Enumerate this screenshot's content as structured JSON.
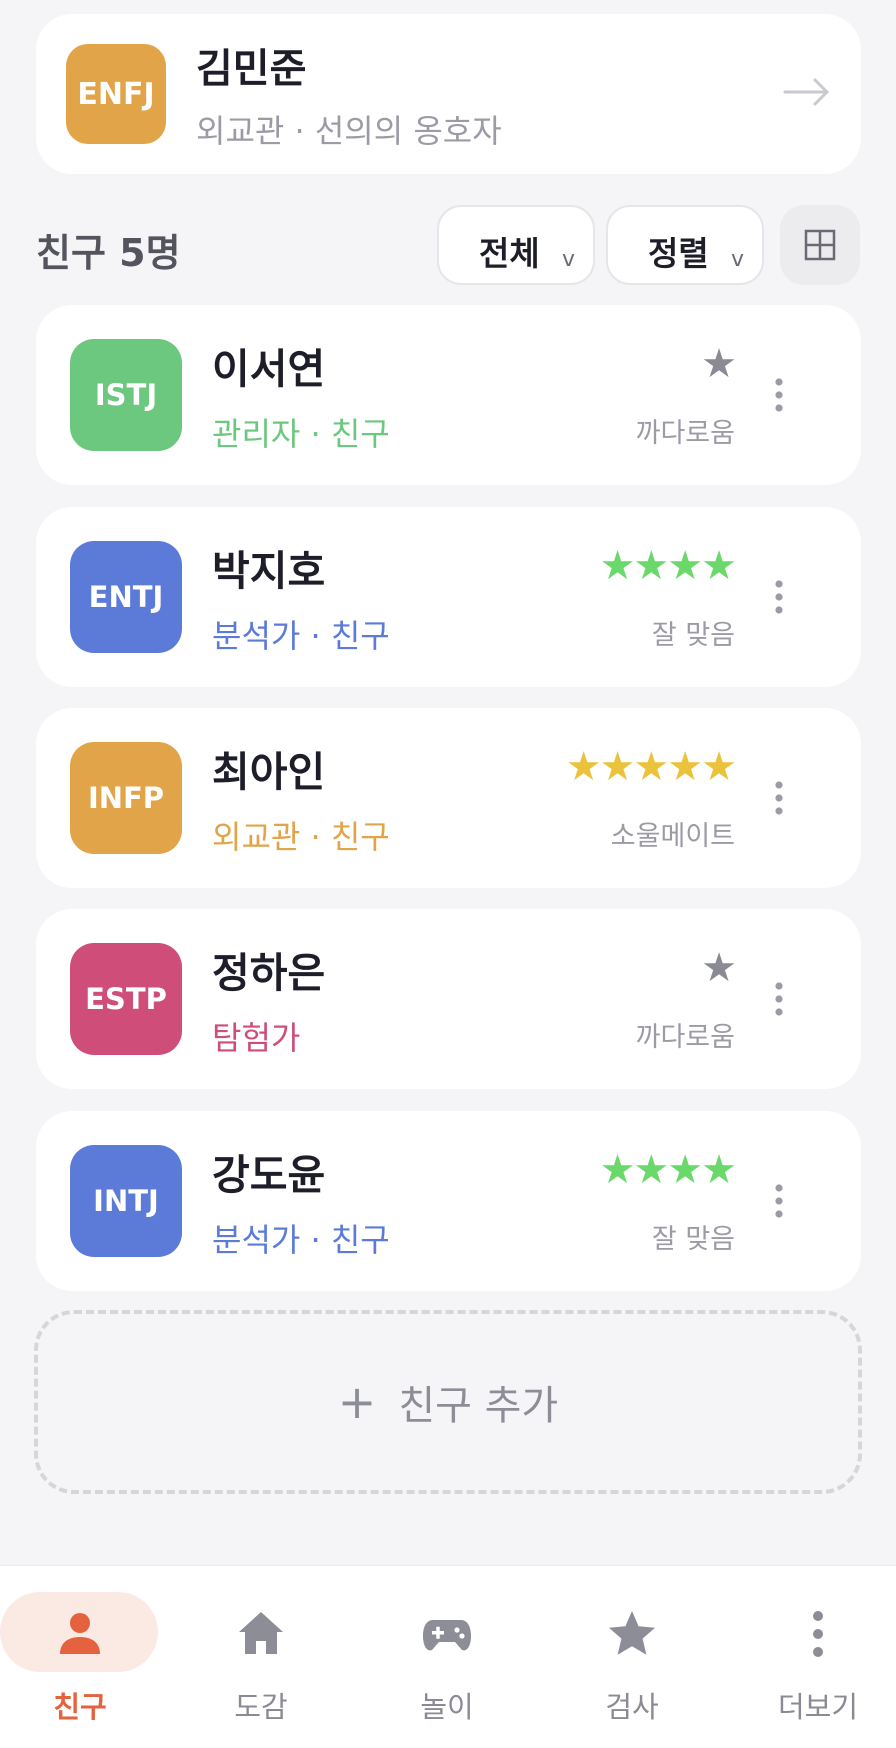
{
  "colors": {
    "accent": "#e4623e",
    "diplomat": "#e2a449",
    "sentinel": "#6cc77f",
    "analyst": "#5c7bd9",
    "explorer": "#cf4e79",
    "star_green": "#6ad86a",
    "star_gold": "#ebc23c",
    "star_gray": "#8a8a94"
  },
  "profile": {
    "mbti": "ENFJ",
    "name": "김민준",
    "subtitle": "외교관 · 선의의 옹호자",
    "arrow_icon": "arrow-right-icon"
  },
  "toolbar": {
    "count_label": "친구 5명",
    "filter_label": "전체",
    "sort_label": "정렬",
    "chevron": "v",
    "grid_icon": "grid-view-icon"
  },
  "friends": [
    {
      "mbti": "ISTJ",
      "name": "이서연",
      "subtitle": "관리자 · 친구",
      "stars": "★",
      "star_count": 1,
      "rating": "까다로움"
    },
    {
      "mbti": "ENTJ",
      "name": "박지호",
      "subtitle": "분석가 · 친구",
      "stars": "★★★★",
      "star_count": 4,
      "rating": "잘 맞음"
    },
    {
      "mbti": "INFP",
      "name": "최아인",
      "subtitle": "외교관 · 친구",
      "stars": "★★★★★",
      "star_count": 5,
      "rating": "소울메이트"
    },
    {
      "mbti": "ESTP",
      "name": "정하은",
      "subtitle": "탐험가",
      "stars": "★",
      "star_count": 1,
      "rating": "까다로움"
    },
    {
      "mbti": "INTJ",
      "name": "강도윤",
      "subtitle": "분석가 · 친구",
      "stars": "★★★★",
      "star_count": 4,
      "rating": "잘 맞음"
    }
  ],
  "add_friend": {
    "plus": "+",
    "label": "친구 추가"
  },
  "nav": {
    "items": [
      {
        "label": "친구",
        "icon": "person-icon",
        "active": true
      },
      {
        "label": "도감",
        "icon": "home-icon",
        "active": false
      },
      {
        "label": "놀이",
        "icon": "gamepad-icon",
        "active": false
      },
      {
        "label": "검사",
        "icon": "star-icon",
        "active": false
      },
      {
        "label": "더보기",
        "icon": "more-vertical-icon",
        "active": false
      }
    ]
  }
}
